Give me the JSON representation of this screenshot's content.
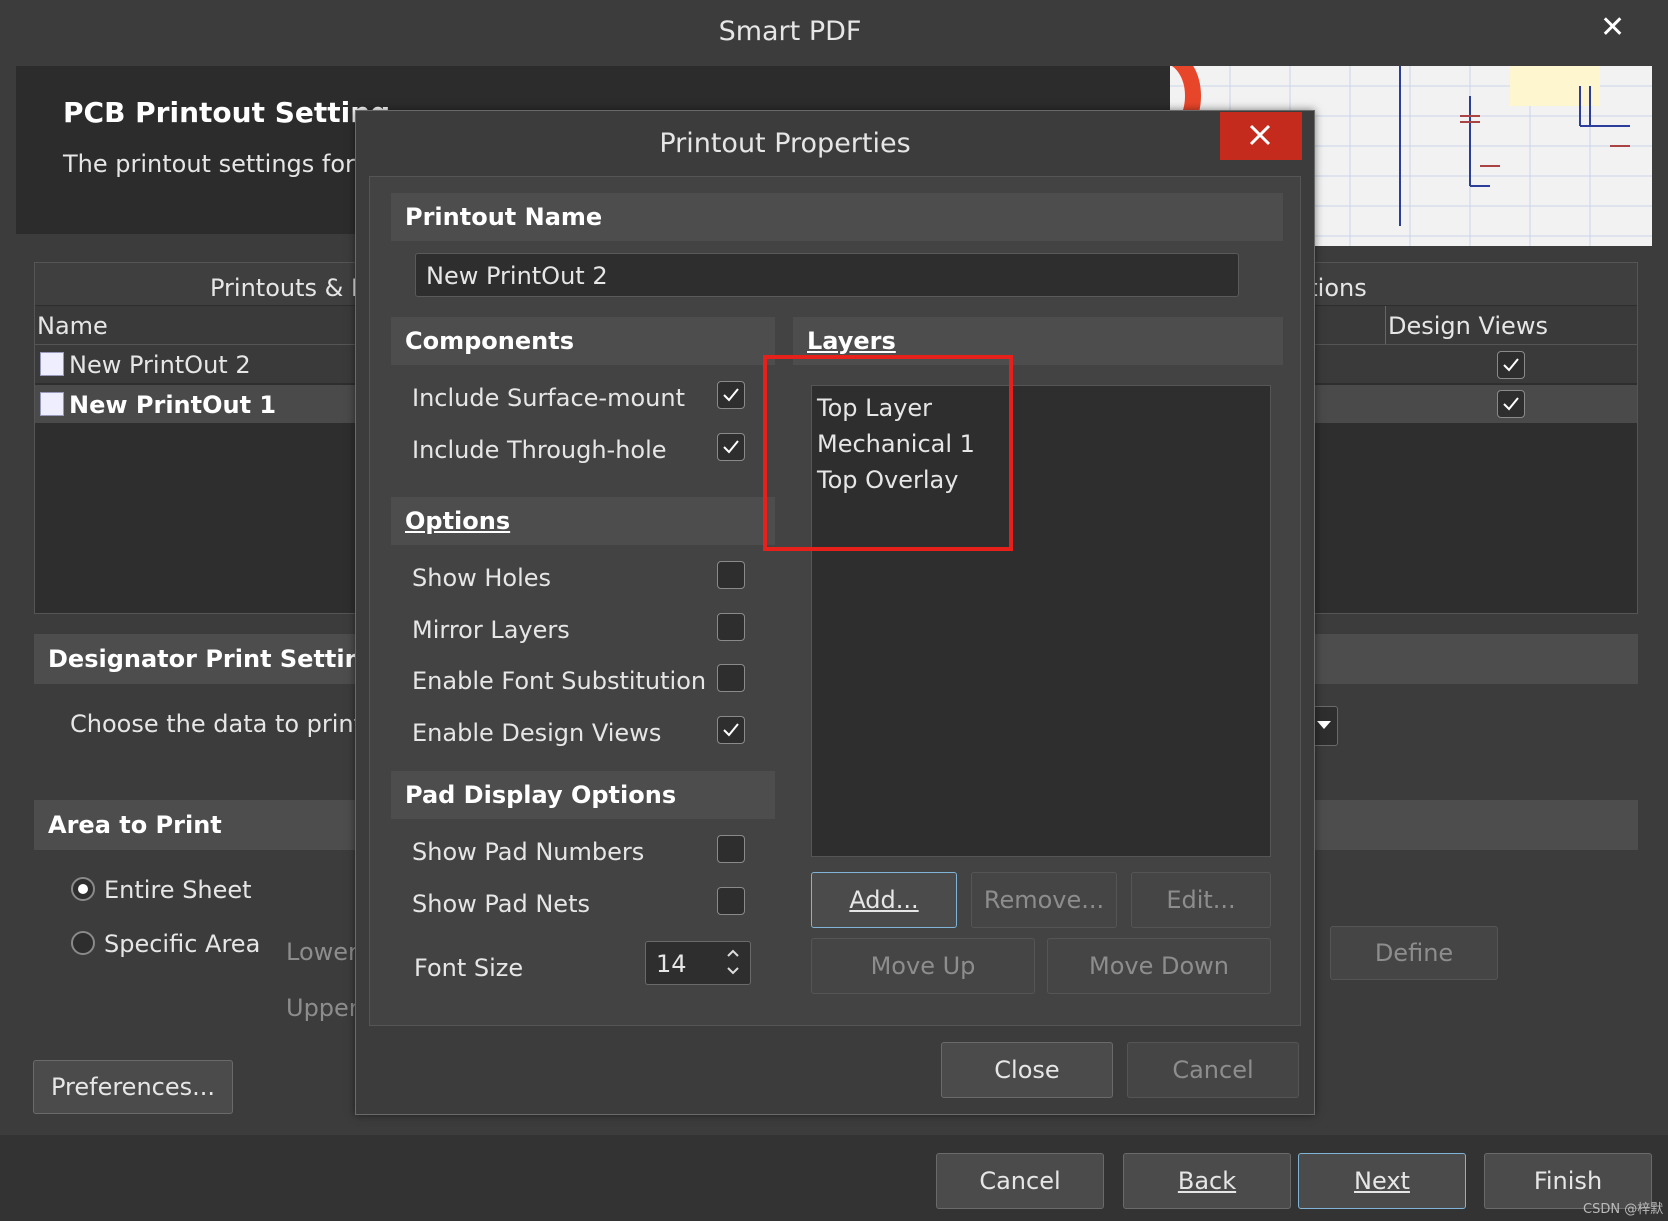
{
  "window": {
    "title": "Smart PDF",
    "close_glyph": "✕"
  },
  "wizard": {
    "heading": "PCB Printout Setting",
    "subheading": "The printout settings for PC",
    "printouts_header": "Printouts & L",
    "options_header": "ptions",
    "name_col": "Name",
    "design_views_col": "Design Views",
    "rows": [
      {
        "label": "New PrintOut 2",
        "design_views": true
      },
      {
        "label": "New PrintOut 1",
        "design_views": true
      }
    ],
    "designator_title": "Designator Print Settings",
    "designator_text": "Choose the data to print i",
    "area_title": "Area to Print",
    "entire_sheet": "Entire Sheet",
    "specific_area": "Specific Area",
    "lower": "Lower",
    "upper": "Upper",
    "define": "Define",
    "preferences": "Preferences...",
    "cancel": "Cancel",
    "back": "Back",
    "next": "Next",
    "finish": "Finish"
  },
  "dialog": {
    "title": "Printout Properties",
    "printout_name_label": "Printout Name",
    "printout_name_value": "New PrintOut 2",
    "components_title": "Components",
    "include_surface_mount": "Include Surface-mount",
    "include_through_hole": "Include Through-hole",
    "options_title": "Options",
    "show_holes": "Show Holes",
    "mirror_layers": "Mirror Layers",
    "enable_font_substitution": "Enable Font Substitution",
    "enable_design_views": "Enable Design Views",
    "pad_display_title": "Pad Display Options",
    "show_pad_numbers": "Show Pad Numbers",
    "show_pad_nets": "Show Pad Nets",
    "font_size_label": "Font Size",
    "font_size_value": "14",
    "layers_title": "Layers",
    "layers": [
      "Top Layer",
      "Mechanical 1",
      "Top Overlay"
    ],
    "add": "Add...",
    "remove": "Remove...",
    "edit": "Edit...",
    "move_up": "Move Up",
    "move_down": "Move Down",
    "close": "Close",
    "cancel": "Cancel"
  },
  "watermark": "CSDN @梓默",
  "colors": {
    "highlight_box": "#e8201c",
    "close_red": "#c42b1c",
    "accent_focus": "#7fb4d6"
  }
}
